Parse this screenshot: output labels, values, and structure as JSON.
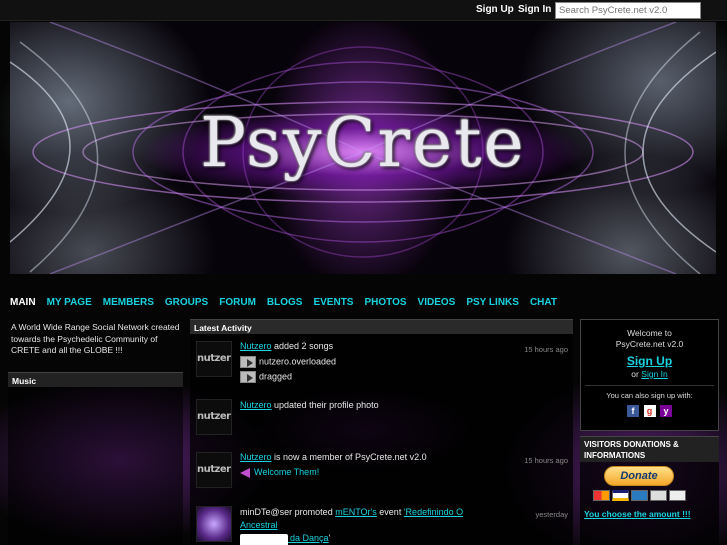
{
  "topbar": {
    "signup": "Sign Up",
    "signin": "Sign In",
    "search_placeholder": "Search PsyCrete.net v2.0"
  },
  "banner": {
    "logo_text": "PsyCrete"
  },
  "nav": {
    "items": [
      "MAIN",
      "MY PAGE",
      "MEMBERS",
      "GROUPS",
      "FORUM",
      "BLOGS",
      "EVENTS",
      "PHOTOS",
      "VIDEOS",
      "PSY LINKS",
      "CHAT"
    ],
    "active": "MAIN"
  },
  "sidebar_left": {
    "intro": "A World Wide Range Social Network created towards the Psychedelic Community of CRETE and all the GLOBE !!!",
    "music_title": "Music"
  },
  "activity": {
    "title": "Latest Activity",
    "items": [
      {
        "thumb": "nutzero",
        "user": "Nutzero",
        "text": "added 2 songs",
        "time": "15 hours ago",
        "songs": [
          "nutzero.overloaded",
          "dragged"
        ]
      },
      {
        "thumb": "nutzero",
        "user": "Nutzero",
        "text": "updated their profile photo"
      },
      {
        "thumb": "nutzero",
        "user": "Nutzero",
        "text": "is now a member of PsyCrete.net v2.0",
        "time": "15 hours ago",
        "cta": "Welcome Them!"
      },
      {
        "user": "minDTe@ser",
        "text_pre": "promoted",
        "target_user": "mENTOr's",
        "text_mid": "event",
        "event_line1": "'Redefinindo O Ancestral",
        "event_line2": "Ritual Tribal da Dança",
        "event_end": "'",
        "time": "yesterday"
      }
    ]
  },
  "welcome_box": {
    "line1": "Welcome to",
    "line2": "PsyCrete.net v2.0",
    "signup": "Sign Up",
    "or": "or",
    "signin": "Sign In",
    "social_text": "You can also sign up with:",
    "social_icons": [
      "facebook-icon",
      "google-icon",
      "yahoo-icon"
    ]
  },
  "donations": {
    "title": "VISITORS DONATIONS & INFORMATIONS",
    "button": "Donate",
    "link": "You choose the amount !!!"
  },
  "colors": {
    "link": "#19d3e0",
    "accent_purple": "#b040e0",
    "background": "#000000"
  }
}
